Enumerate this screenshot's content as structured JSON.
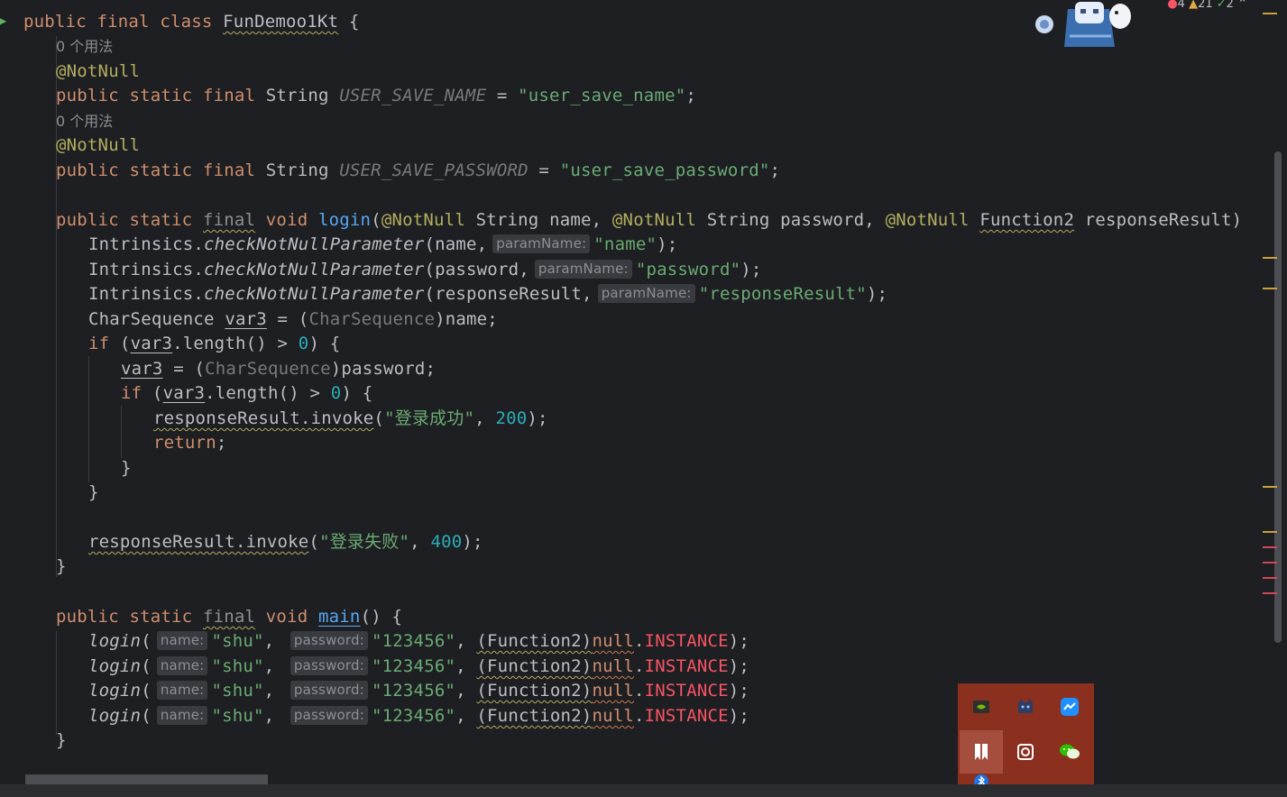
{
  "editor": {
    "class_decl": {
      "public": "public",
      "final": "final",
      "class": "class",
      "name": "FunDemoo1Kt",
      "brace": " {"
    },
    "usage_hint_1": "0 个用法",
    "usage_hint_2": "0 个用法",
    "annotation": "@NotNull",
    "field1": {
      "mods": "public static final",
      "type": " String ",
      "name": "USER_SAVE_NAME",
      "eq": " = ",
      "value": "\"user_save_name\"",
      "end": ";"
    },
    "field2": {
      "mods": "public static final",
      "type": " String ",
      "name": "USER_SAVE_PASSWORD",
      "eq": " = ",
      "value": "\"user_save_password\"",
      "end": ";"
    },
    "login_sig": {
      "mods": "public static",
      "final": "final",
      "void": "void",
      "name": "login",
      "p1": "String name, ",
      "p2": "String password, ",
      "p3type": "Function2",
      "p3": " responseResult)"
    },
    "check": {
      "receiver": "Intrinsics.",
      "method": "checkNotNullParameter",
      "hint": "paramName:",
      "args": [
        {
          "arg": "(name,",
          "value": "\"name\"",
          "end": ");"
        },
        {
          "arg": "(password,",
          "value": "\"password\"",
          "end": ");"
        },
        {
          "arg": "(responseResult,",
          "value": "\"responseResult\"",
          "end": ");"
        }
      ]
    },
    "charseq": {
      "type": "CharSequence ",
      "var": "var3",
      "eq": " = (",
      "cast": "CharSequence",
      "rest": ")name;"
    },
    "if1": {
      "kw": "if",
      "open": " (",
      "var": "var3",
      "mid": ".length() > ",
      "num": "0",
      "close": ") {"
    },
    "assign": {
      "var": "var3",
      "eq": " = (",
      "cast": "CharSequence",
      "rest": ")password;"
    },
    "if2": {
      "kw": "if",
      "open": " (",
      "var": "var3",
      "mid": ".length() > ",
      "num": "0",
      "close": ") {"
    },
    "invoke_ok": {
      "call": "responseResult.invoke",
      "open": "(",
      "msg": "\"登录成功\"",
      "comma": ", ",
      "code": "200",
      "end": ");"
    },
    "return_kw": "return",
    "return_end": ";",
    "close_brace": "}",
    "invoke_fail": {
      "call": "responseResult.invoke",
      "open": "(",
      "msg": "\"登录失败\"",
      "comma": ", ",
      "code": "400",
      "end": ");"
    },
    "main_sig": {
      "mods": "public static",
      "final": "final",
      "void": "void",
      "name": "main",
      "rest": "() {"
    },
    "main_calls": [
      {
        "fn": "login",
        "open": "(",
        "hint1": "name:",
        "v1": "\"shu\"",
        "c1": ",",
        "hint2": "password:",
        "v2": "\"123456\"",
        "c2": ",",
        "cast": "(Function2)",
        "nul": "null",
        "dot": ".",
        "inst": "INSTANCE",
        "end": ");"
      },
      {
        "fn": "login",
        "open": "(",
        "hint1": "name:",
        "v1": "\"shu\"",
        "c1": ",",
        "hint2": "password:",
        "v2": "\"123456\"",
        "c2": ",",
        "cast": "(Function2)",
        "nul": "null",
        "dot": ".",
        "inst": "INSTANCE",
        "end": ");"
      },
      {
        "fn": "login",
        "open": "(",
        "hint1": "name:",
        "v1": "\"shu\"",
        "c1": ",",
        "hint2": "password:",
        "v2": "\"123456\"",
        "c2": ",",
        "cast": "(Function2)",
        "nul": "null",
        "dot": ".",
        "inst": "INSTANCE",
        "end": ");"
      },
      {
        "fn": "login",
        "open": "(",
        "hint1": "name:",
        "v1": "\"shu\"",
        "c1": ",",
        "hint2": "password:",
        "v2": "\"123456\"",
        "c2": ",",
        "cast": "(Function2)",
        "nul": "null",
        "dot": ".",
        "inst": "INSTANCE",
        "end": ");"
      }
    ]
  },
  "inspections": {
    "errors": "4",
    "warnings": "21",
    "weak": "2"
  },
  "colors": {
    "background": "#1e1f22",
    "keyword": "#cf8e6d",
    "string": "#6aab73",
    "number": "#2aacb8",
    "annotation": "#b3ae60",
    "function": "#56a8f5",
    "constant": "#c77dbb",
    "error": "#f75464",
    "tray": "#8b2f1e"
  },
  "tray_icons": [
    "nvidia-icon",
    "cat-app-icon",
    "chat-app-icon",
    "pin-app-icon",
    "screenshot-app-icon",
    "wechat-icon",
    "bluetooth-icon"
  ]
}
